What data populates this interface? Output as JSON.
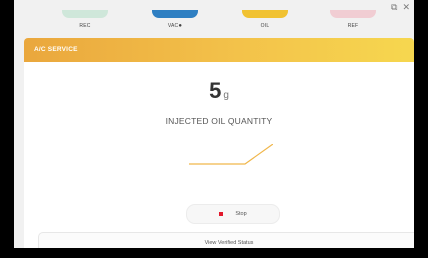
{
  "window": {
    "controls": [
      "⧉",
      "✕"
    ]
  },
  "steps": [
    {
      "label": "REC",
      "color": "#cfe7da"
    },
    {
      "label": "VAC",
      "color": "#2f7fc2",
      "has_info": true
    },
    {
      "label": "OIL",
      "color": "#f1c232"
    },
    {
      "label": "REF",
      "color": "#f1cdd3"
    }
  ],
  "card": {
    "title": "A/C SERVICE",
    "value": "5",
    "unit": "g",
    "caption": "INJECTED OIL QUANTITY"
  },
  "stop_button": {
    "label": "Stop"
  },
  "footer": {
    "label": "View Verified Status"
  },
  "colors": {
    "accent_start": "#eaa73d",
    "accent_end": "#f6d74f",
    "stop_red": "#e2182c",
    "graph_line": "#f0b64a"
  }
}
